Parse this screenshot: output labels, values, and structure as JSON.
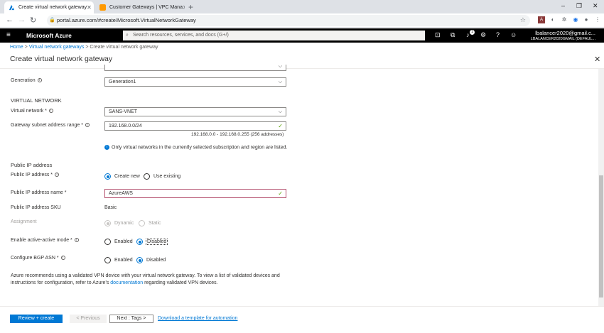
{
  "browser": {
    "tabs": [
      {
        "title": "Create virtual network gateway",
        "active": true
      },
      {
        "title": "Customer Gateways | VPC Mana",
        "active": false
      }
    ],
    "new_tab": "+",
    "url": "portal.azure.com/#create/Microsoft.VirtualNetworkGateway",
    "window_controls": [
      "–",
      "❐",
      "✕"
    ]
  },
  "azure_header": {
    "brand": "Microsoft Azure",
    "search_placeholder": "Search resources, services, and docs (G+/)",
    "notification_count": "1",
    "account_email": "lbalancer2020@gmail.c...",
    "account_directory": "LBALANCER2020GMAIL (DEFAUL..."
  },
  "breadcrumb": {
    "items": [
      "Home",
      "Virtual network gateways",
      "Create virtual network gateway"
    ]
  },
  "blade": {
    "title": "Create virtual network gateway"
  },
  "form": {
    "generation": {
      "label": "Generation",
      "value": "Generation1"
    },
    "virtual_network_section": "VIRTUAL NETWORK",
    "virtual_network": {
      "label": "Virtual network *",
      "value": "SANS-VNET"
    },
    "gateway_subnet": {
      "label": "Gateway subnet address range *",
      "value": "192.168.0.0/24",
      "hint": "192.168.0.0 - 192.168.0.255 (256 addresses)"
    },
    "vnet_note": "Only virtual networks in the currently selected subscription and region are listed.",
    "public_ip_section": "Public IP address",
    "public_ip": {
      "label": "Public IP address *",
      "options": [
        "Create new",
        "Use existing"
      ],
      "selected": "Create new"
    },
    "public_ip_name": {
      "label": "Public IP address name *",
      "value": "AzureAWS"
    },
    "public_ip_sku": {
      "label": "Public IP address SKU",
      "value": "Basic"
    },
    "assignment": {
      "label": "Assignment",
      "options": [
        "Dynamic",
        "Static"
      ],
      "selected": "Dynamic"
    },
    "active_active": {
      "label": "Enable active-active mode *",
      "options": [
        "Enabled",
        "Disabled"
      ],
      "selected": "Disabled"
    },
    "bgp": {
      "label": "Configure BGP ASN *",
      "options": [
        "Enabled",
        "Disabled"
      ],
      "selected": "Disabled"
    },
    "recommendation_pre": "Azure recommends using a validated VPN device with your virtual network gateway. To view a list of validated devices and instructions for configuration, refer to Azure's ",
    "recommendation_link": "documentation",
    "recommendation_post": " regarding validated VPN devices."
  },
  "footer": {
    "review_create": "Review + create",
    "previous": "< Previous",
    "next": "Next : Tags >",
    "download_template": "Download a template for automation"
  }
}
